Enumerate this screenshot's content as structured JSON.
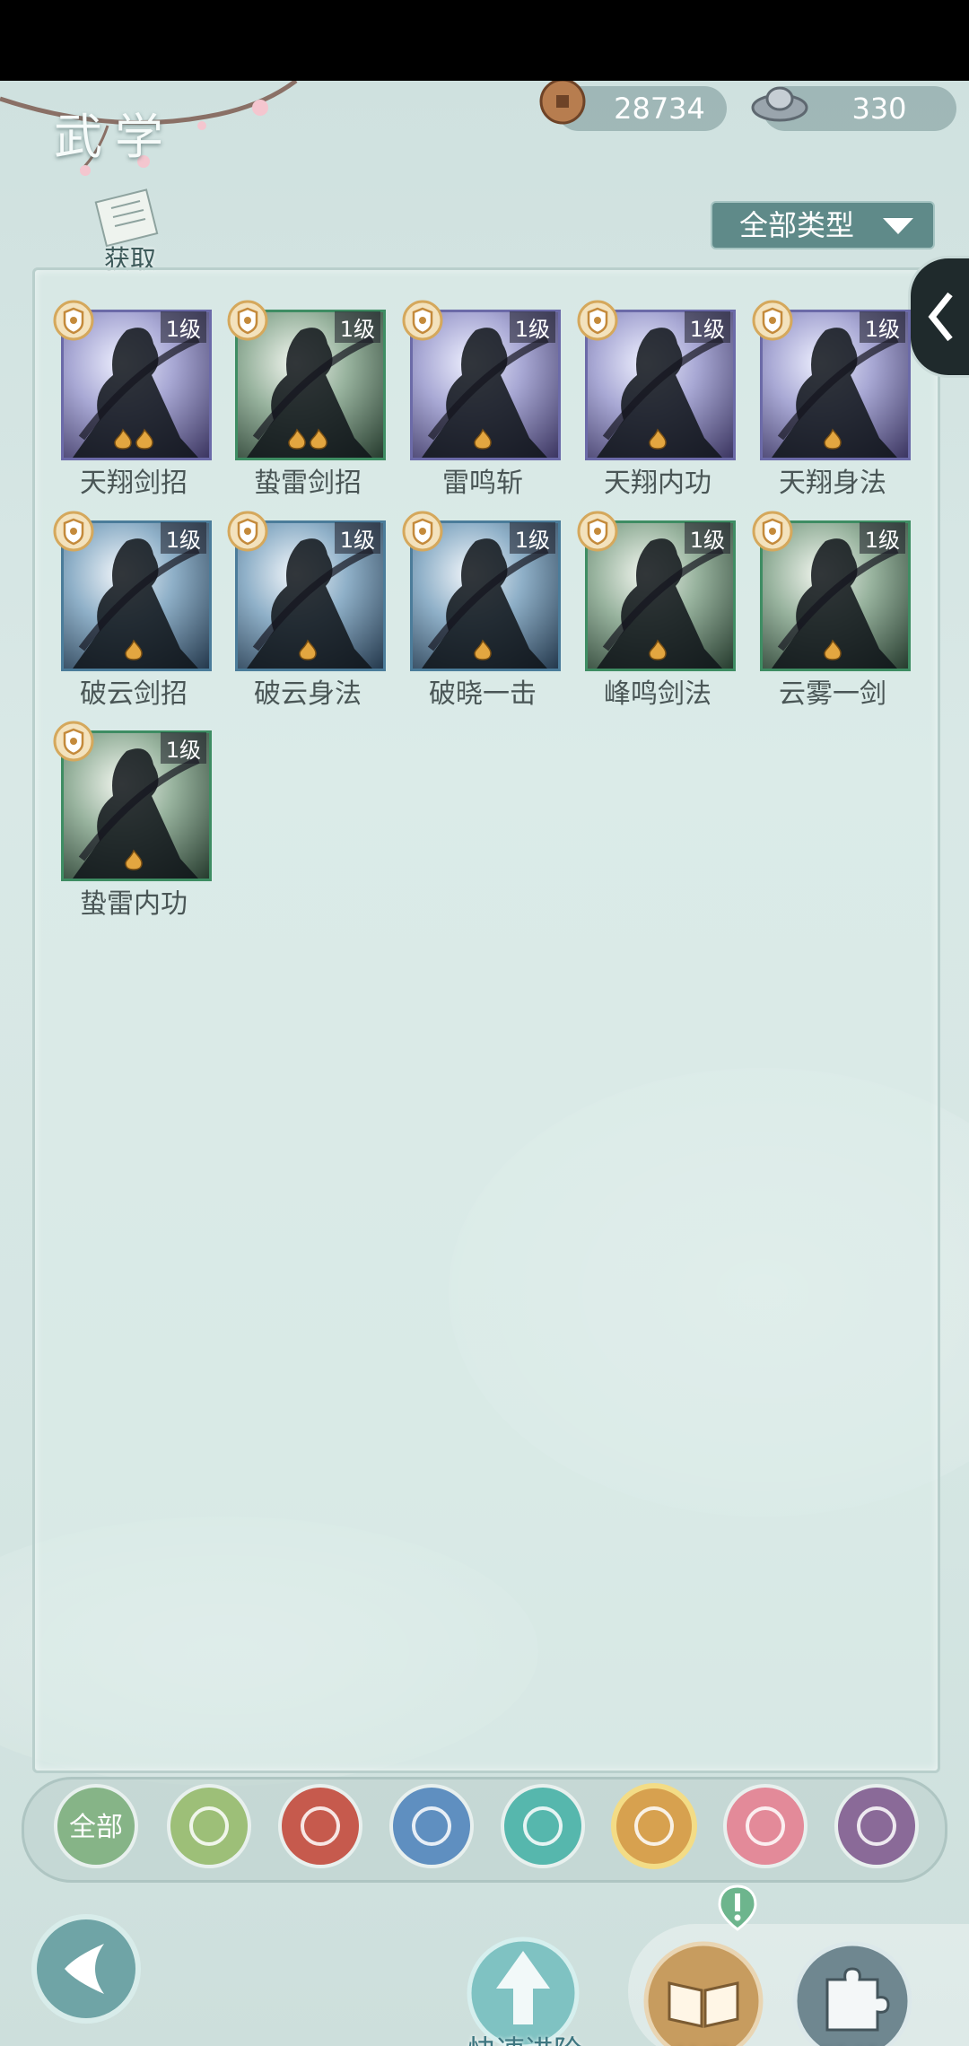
{
  "header": {
    "title": "武学",
    "copper_coins": "28734",
    "silver_ingots": "330"
  },
  "toolbar": {
    "get_label": "获取",
    "type_filter": "全部类型"
  },
  "skills": [
    {
      "name": "天翔剑招",
      "level": "1级",
      "color": "purple",
      "flames": 2
    },
    {
      "name": "蛰雷剑招",
      "level": "1级",
      "color": "green",
      "flames": 2
    },
    {
      "name": "雷鸣斩",
      "level": "1级",
      "color": "purple",
      "flames": 1
    },
    {
      "name": "天翔内功",
      "level": "1级",
      "color": "purple",
      "flames": 1
    },
    {
      "name": "天翔身法",
      "level": "1级",
      "color": "purple",
      "flames": 1
    },
    {
      "name": "破云剑招",
      "level": "1级",
      "color": "blue",
      "flames": 1
    },
    {
      "name": "破云身法",
      "level": "1级",
      "color": "blue",
      "flames": 1
    },
    {
      "name": "破晓一击",
      "level": "1级",
      "color": "blue",
      "flames": 1
    },
    {
      "name": "峰鸣剑法",
      "level": "1级",
      "color": "green",
      "flames": 1
    },
    {
      "name": "云雾一剑",
      "level": "1级",
      "color": "green",
      "flames": 1
    },
    {
      "name": "蛰雷内功",
      "level": "1级",
      "color": "green",
      "flames": 1
    }
  ],
  "categories": [
    {
      "icon": "all-icon",
      "label": "全部",
      "color": "#86b487"
    },
    {
      "icon": "sword-icon",
      "color": "#9dbf78"
    },
    {
      "icon": "fire-icon",
      "color": "#c65a4d"
    },
    {
      "icon": "wave-icon",
      "color": "#5f8fc0"
    },
    {
      "icon": "butterfly-icon",
      "color": "#56b7ad"
    },
    {
      "icon": "shield-icon",
      "color": "#d7a14f",
      "selected": true
    },
    {
      "icon": "moon-icon",
      "color": "#e38a99"
    },
    {
      "icon": "rose-icon",
      "color": "#8a6a98"
    }
  ],
  "bottom": {
    "quick_advance": "快速进阶",
    "overview": "总览",
    "fragments": "碎片"
  }
}
